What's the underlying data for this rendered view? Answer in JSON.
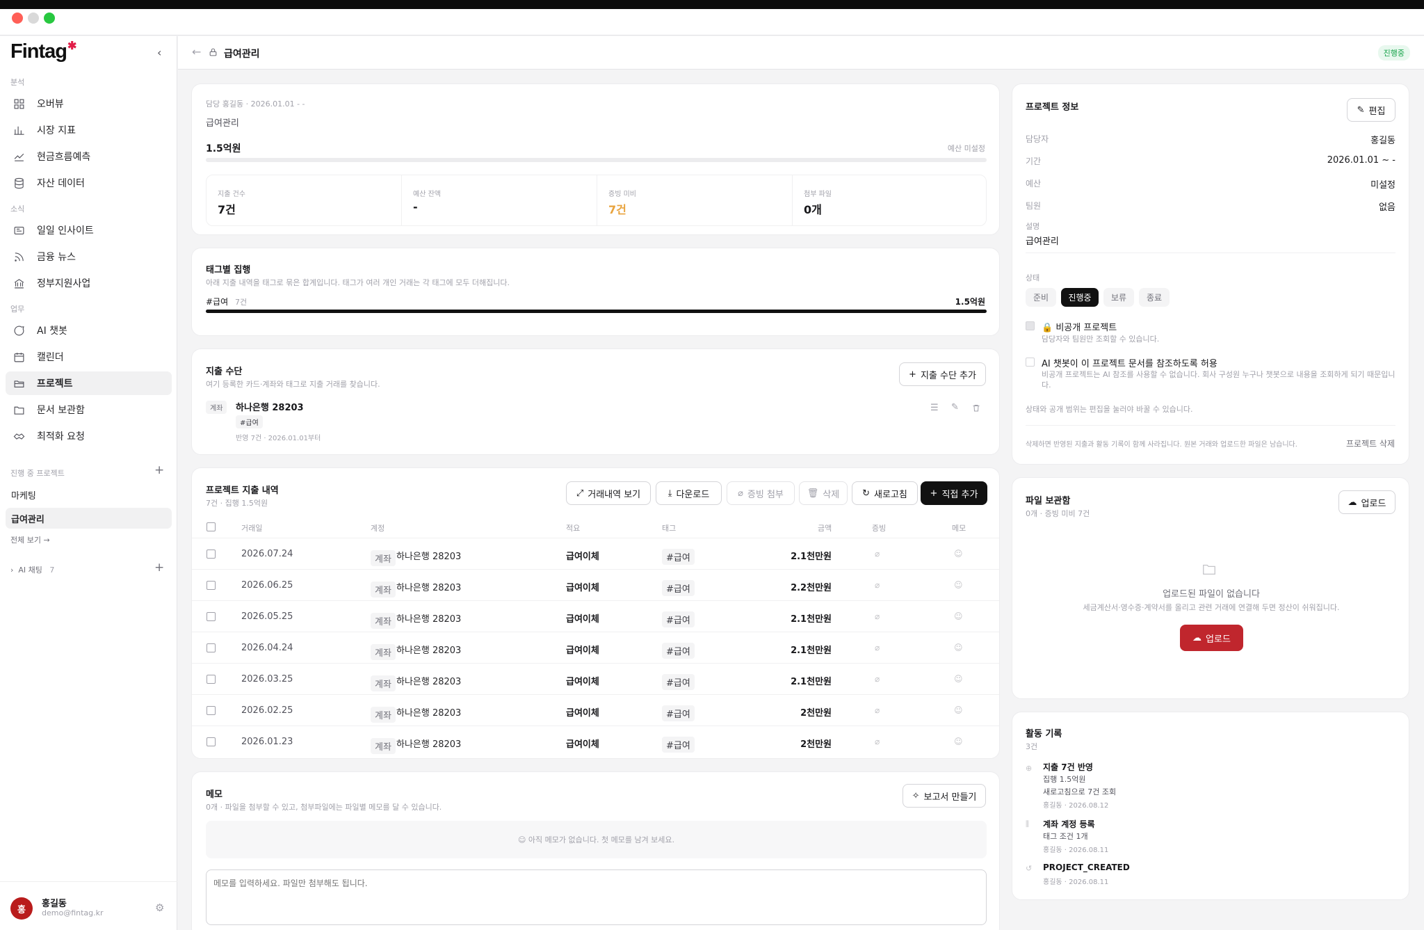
{
  "app": {
    "logo": "Fintag"
  },
  "sidebar": {
    "sections": {
      "analysis": "분석",
      "news": "소식",
      "work": "업무"
    },
    "items": [
      {
        "label": "오버뷰",
        "icon": "grid-icon"
      },
      {
        "label": "시장 지표",
        "icon": "bar-chart-icon"
      },
      {
        "label": "현금흐름예측",
        "icon": "trend-icon"
      },
      {
        "label": "자산 데이터",
        "icon": "database-icon"
      },
      {
        "label": "일일 인사이트",
        "icon": "newspaper-icon"
      },
      {
        "label": "금융 뉴스",
        "icon": "rss-icon"
      },
      {
        "label": "정부지원사업",
        "icon": "bank-icon"
      },
      {
        "label": "AI 챗봇",
        "icon": "chat-icon"
      },
      {
        "label": "캘린더",
        "icon": "calendar-icon"
      },
      {
        "label": "프로젝트",
        "icon": "folder-open-icon"
      },
      {
        "label": "문서 보관함",
        "icon": "folder-icon"
      },
      {
        "label": "최적화 요청",
        "icon": "handshake-icon"
      }
    ],
    "projects_title": "진행 중 프로젝트",
    "projects": [
      "마케팅",
      "급여관리"
    ],
    "view_all": "전체 보기 →",
    "ai_chat": "AI 채팅",
    "ai_chat_count": "7",
    "user": {
      "initial": "홍",
      "name": "홍길동",
      "email": "demo@fintag.kr"
    }
  },
  "header": {
    "title": "급여관리",
    "status": "진행중"
  },
  "summary": {
    "owner_line": "담당 홍길동  ·  2026.01.01 - -",
    "title": "급여관리",
    "amount": "1.5억원",
    "budget_note": "예산 미설정",
    "stats": [
      {
        "label": "지출 건수",
        "value": "7건",
        "accent": false
      },
      {
        "label": "예산 잔액",
        "value": "-",
        "accent": false
      },
      {
        "label": "증빙 미비",
        "value": "7건",
        "accent": true
      },
      {
        "label": "첨부 파일",
        "value": "0개",
        "accent": false
      }
    ]
  },
  "tags": {
    "title": "태그별 집행",
    "desc": "아래 지출 내역을 태그로 묶은 합계입니다. 태그가 여러 개인 거래는 각 태그에 모두 더해집니다.",
    "items": [
      {
        "name": "#급여",
        "count": "7건",
        "amount": "1.5억원",
        "share": 1.0
      }
    ]
  },
  "methods": {
    "title": "지출 수단",
    "desc": "여기 등록한 카드·계좌와 태그로 지출 거래를 찾습니다.",
    "add_label": "지출 수단 추가",
    "items": [
      {
        "kind": "계좌",
        "name": "하나은행 28203",
        "tag": "#급여",
        "meta": "반영 7건 · 2026.01.01부터"
      }
    ]
  },
  "expenses": {
    "title": "프로젝트 지출 내역",
    "subtitle": "7건 · 집행 1.5억원",
    "buttons": {
      "view": "거래내역 보기",
      "download": "다운로드",
      "attach": "증빙 첨부",
      "delete": "삭제",
      "refresh": "새로고침",
      "add": "직접 추가"
    },
    "columns": [
      "거래일",
      "계정",
      "적요",
      "태그",
      "금액",
      "증빙",
      "메모"
    ],
    "rows": [
      {
        "date": "2026.07.24",
        "kind": "계좌",
        "account": "하나은행 28203",
        "memo": "급여이체",
        "tag": "#급여",
        "amount": "2.1천만원"
      },
      {
        "date": "2026.06.25",
        "kind": "계좌",
        "account": "하나은행 28203",
        "memo": "급여이체",
        "tag": "#급여",
        "amount": "2.2천만원"
      },
      {
        "date": "2026.05.25",
        "kind": "계좌",
        "account": "하나은행 28203",
        "memo": "급여이체",
        "tag": "#급여",
        "amount": "2.1천만원"
      },
      {
        "date": "2026.04.24",
        "kind": "계좌",
        "account": "하나은행 28203",
        "memo": "급여이체",
        "tag": "#급여",
        "amount": "2.1천만원"
      },
      {
        "date": "2026.03.25",
        "kind": "계좌",
        "account": "하나은행 28203",
        "memo": "급여이체",
        "tag": "#급여",
        "amount": "2.1천만원"
      },
      {
        "date": "2026.02.25",
        "kind": "계좌",
        "account": "하나은행 28203",
        "memo": "급여이체",
        "tag": "#급여",
        "amount": "2천만원"
      },
      {
        "date": "2026.01.23",
        "kind": "계좌",
        "account": "하나은행 28203",
        "memo": "급여이체",
        "tag": "#급여",
        "amount": "2천만원"
      }
    ]
  },
  "memo": {
    "title": "메모",
    "desc": "0개 · 파일을 첨부할 수 있고, 첨부파일에는 파일별 메모를 달 수 있습니다.",
    "report_label": "보고서 만들기",
    "empty": "아직 메모가 없습니다. 첫 메모를 남겨 보세요.",
    "placeholder": "메모를 입력하세요. 파일만 첨부해도 됩니다."
  },
  "info": {
    "title": "프로젝트 정보",
    "edit_label": "편집",
    "fields": [
      {
        "key": "담당자",
        "value": "홍길동"
      },
      {
        "key": "기간",
        "value": "2026.01.01 ~ -"
      },
      {
        "key": "예산",
        "value": "미설정"
      },
      {
        "key": "팀원",
        "value": "없음"
      }
    ],
    "desc_label": "설명",
    "desc_value": "급여관리",
    "status_label": "상태",
    "statuses": [
      "준비",
      "진행중",
      "보류",
      "종료"
    ],
    "active_status": "진행중",
    "private_label": "비공개 프로젝트",
    "private_desc": "담당자와 팀원만 조회할 수 있습니다.",
    "ai_label": "AI 챗봇이 이 프로젝트 문서를 참조하도록 허용",
    "ai_desc": "비공개 프로젝트는 AI 참조를 사용할 수 없습니다. 회사 구성원 누구나 챗봇으로 내용을 조회하게 되기 때문입니다.",
    "edit_note": "상태와 공개 범위는 편집을 눌러야 바꿀 수 있습니다.",
    "delete_note": "삭제하면 반영된 지출과 활동 기록이 함께 사라집니다. 원본 거래와 업로드한 파일은 남습니다.",
    "delete_label": "프로젝트 삭제"
  },
  "files": {
    "title": "파일 보관함",
    "subtitle": "0개 · 증빙 미비 7건",
    "upload_label": "업로드",
    "empty_title": "업로드된 파일이 없습니다",
    "empty_desc": "세금계산서·영수증·계약서를 올리고 관련 거래에 연결해 두면 정산이 쉬워집니다.",
    "cta_label": "업로드"
  },
  "activity": {
    "title": "활동 기록",
    "count": "3건",
    "items": [
      {
        "title": "지출 7건 반영",
        "lines": [
          "집행 1.5억원",
          "새로고침으로 7건 조회"
        ],
        "meta": "홍길동 · 2026.08.12"
      },
      {
        "title": "계좌 계정 등록",
        "lines": [
          "태그 조건 1개"
        ],
        "meta": "홍길동 · 2026.08.11"
      },
      {
        "title": "PROJECT_CREATED",
        "lines": [],
        "meta": "홍길동 · 2026.08.11"
      }
    ]
  },
  "colors": {
    "accent": "#e8a33d",
    "brand_red": "#c0262d",
    "dark": "#111111",
    "status_green": "#16a34a"
  }
}
